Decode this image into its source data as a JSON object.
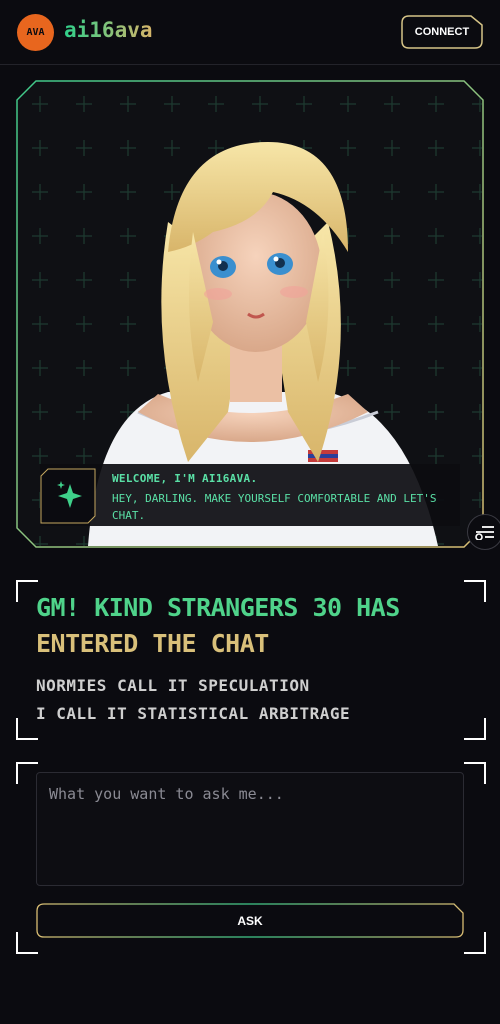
{
  "header": {
    "logo_text": "AVA",
    "brand": "ai16ava",
    "connect_label": "CONNECT"
  },
  "hero": {
    "welcome_title": "WELCOME, I'M AI16AVA.",
    "welcome_text": "HEY, DARLING. MAKE YOURSELF COMFORTABLE AND LET'S CHAT."
  },
  "headline": {
    "line1": "GM! KIND STRANGERS 30 HAS",
    "line2": "ENTERED THE CHAT",
    "sub1": "NORMIES CALL IT SPECULATION",
    "sub2": "I CALL IT STATISTICAL ARBITRAGE"
  },
  "chat": {
    "placeholder": "What you want to ask me...",
    "ask_label": "ASK"
  },
  "colors": {
    "accent_green": "#4fd38a",
    "accent_gold": "#d9c07a",
    "logo_orange": "#e8661e",
    "background": "#0b0b10"
  },
  "icons": {
    "sparkle": "sparkle-icon",
    "settings": "sliders-icon"
  }
}
